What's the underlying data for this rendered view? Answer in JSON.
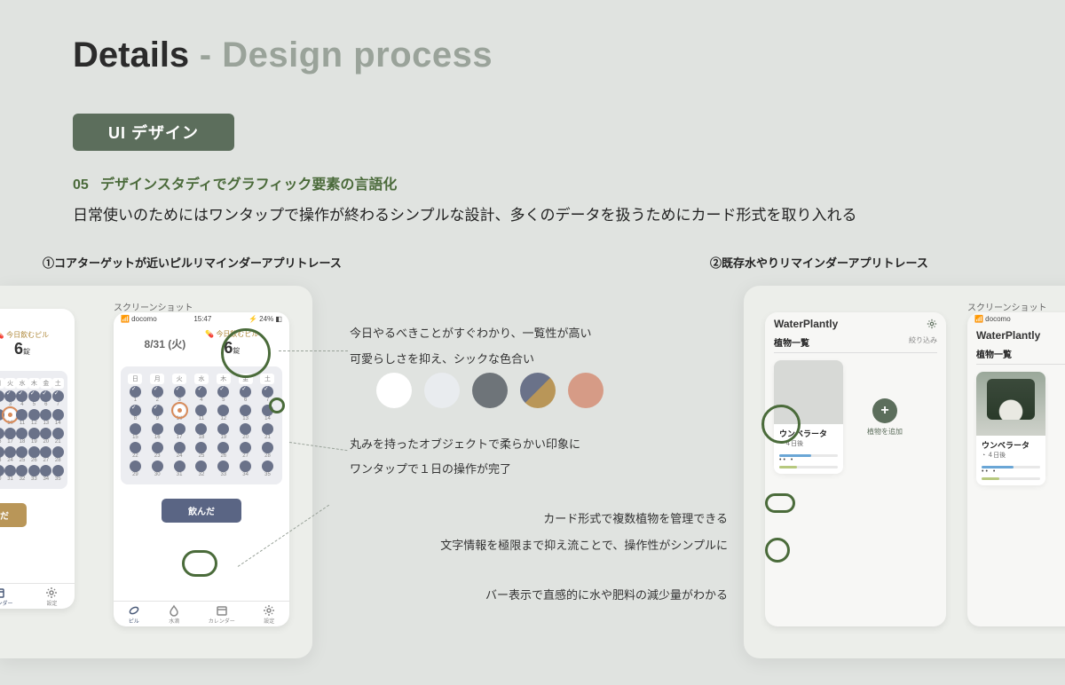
{
  "title": {
    "strong": "Details",
    "sep": " - ",
    "light": "Design process"
  },
  "section_pill": "UI デザイン",
  "step": {
    "num": "05",
    "label": "デザインスタディでグラフィック要素の言語化"
  },
  "lead": "日常使いのためにはワンタップで操作が終わるシンプルな設計、多くのデータを扱うためにカード形式を取り入れる",
  "columns": {
    "left": "①コアターゲットが近いピルリマインダーアプリトレース",
    "right": "②既存水やりリマインダーアプリトレース"
  },
  "screenshot_label": "スクリーンショット",
  "statusbar": {
    "carrier": "📶 docomo",
    "time": "15:47",
    "battery": "⚡ 24% ◧"
  },
  "pill": {
    "date": "8/31 (火)",
    "today_label": "今日飲むピル",
    "today_count": "6",
    "today_unit": "錠",
    "weekdays": [
      "日",
      "月",
      "火",
      "水",
      "木",
      "金",
      "土"
    ],
    "taken_btn": "飲んだ"
  },
  "tabs": {
    "pill": "ピル",
    "water": "水滴",
    "cal": "カレンダー",
    "set": "設定"
  },
  "annotations": {
    "a1": "今日やるべきことがすぐわかり、一覧性が高い",
    "a2": "可愛らしさを抑え、シックな色合い",
    "a3": "丸みを持ったオブジェクトで柔らかい印象に",
    "a4": "ワンタップで１日の操作が完了",
    "b1": "カード形式で複数植物を管理できる",
    "b2": "文字情報を極限まで抑え流ことで、操作性がシンプルに",
    "b3": "バー表示で直感的に水や肥料の減少量がわかる"
  },
  "palette": [
    "#ffffff",
    "#e9ecef",
    "#6e7479",
    "split",
    "#d69b86"
  ],
  "wp": {
    "app_title": "WaterPlantly",
    "list_heading": "植物一覧",
    "filter": "絞り込み",
    "plant_name": "ウンベラータ",
    "plant_sub": "４日後",
    "add_label": "植物を追加"
  }
}
